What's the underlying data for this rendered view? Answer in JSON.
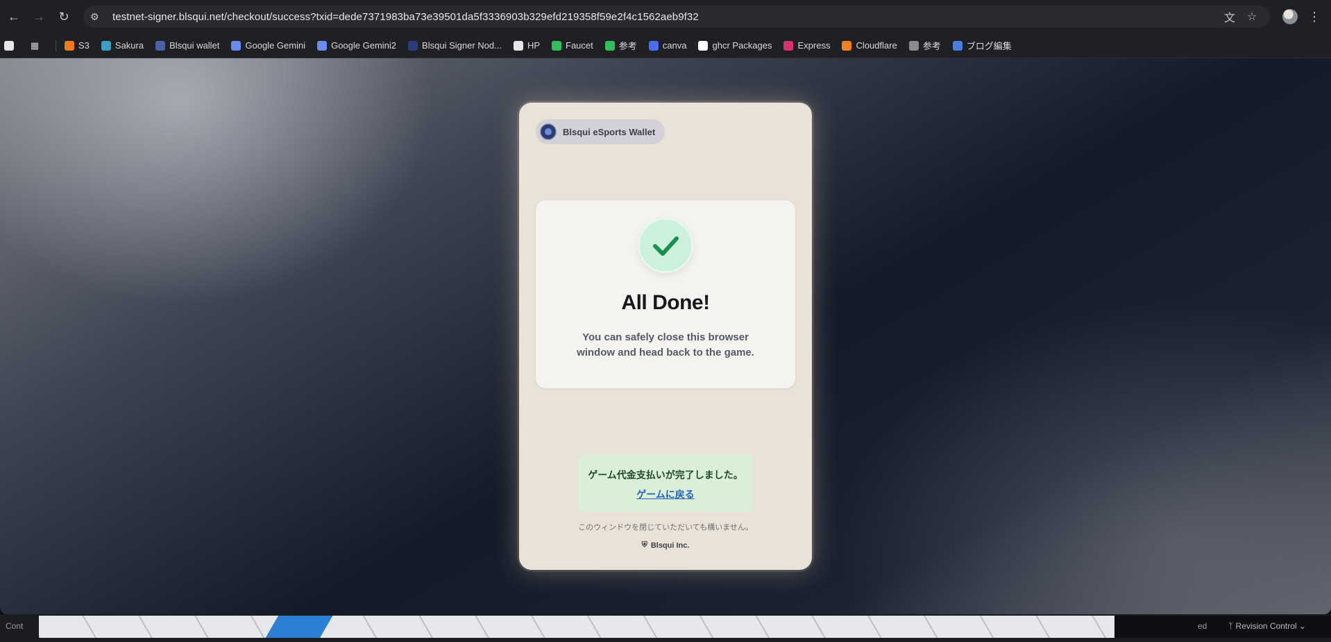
{
  "browser": {
    "url": "testnet-signer.blsqui.net/checkout/success?txid=dede7371983ba73e39501da5f3336903b329efd219358f59e2f4c1562aeb9f32",
    "icons": {
      "back": "back-arrow-icon",
      "forward": "forward-arrow-icon",
      "reload": "reload-icon",
      "translate": "translate-icon",
      "star": "bookmark-star-icon",
      "menu": "kebab-menu-icon"
    }
  },
  "bookmarks": [
    {
      "label": "S3",
      "color": "#f07b1a"
    },
    {
      "label": "Sakura",
      "color": "#3aa0c8"
    },
    {
      "label": "Blsqui wallet",
      "color": "#4a62a8"
    },
    {
      "label": "Google Gemini",
      "color": "#6b8af0"
    },
    {
      "label": "Google Gemini2",
      "color": "#6b8af0"
    },
    {
      "label": "Blsqui Signer Nod...",
      "color": "#2a3d78"
    },
    {
      "label": "HP",
      "color": "#e6e6e6"
    },
    {
      "label": "Faucet",
      "color": "#2fbf5f"
    },
    {
      "label": "参考",
      "color": "#2fbf5f"
    },
    {
      "label": "canva",
      "color": "#4b6cf0"
    },
    {
      "label": "ghcr Packages",
      "color": "#ffffff"
    },
    {
      "label": "Express",
      "color": "#d6336c"
    },
    {
      "label": "Cloudflare",
      "color": "#f38020"
    },
    {
      "label": "参考",
      "color": "#8a8b90"
    },
    {
      "label": "ブログ編集",
      "color": "#4a7de0"
    }
  ],
  "card": {
    "brand": "Blsqui eSports Wallet",
    "title": "All Done!",
    "message": "You can safely close this browser window and head back to the game.",
    "jp_complete": "ゲーム代金支払いが完了しました。",
    "jp_back_link": "ゲームに戻る",
    "jp_note": "このウィンドウを閉じていただいても構いません。",
    "footer": "Blsqui Inc.",
    "accent_green": "#1f9d57"
  },
  "status": {
    "left": "Cont",
    "ed": "ed",
    "revision": "Revision Control"
  }
}
